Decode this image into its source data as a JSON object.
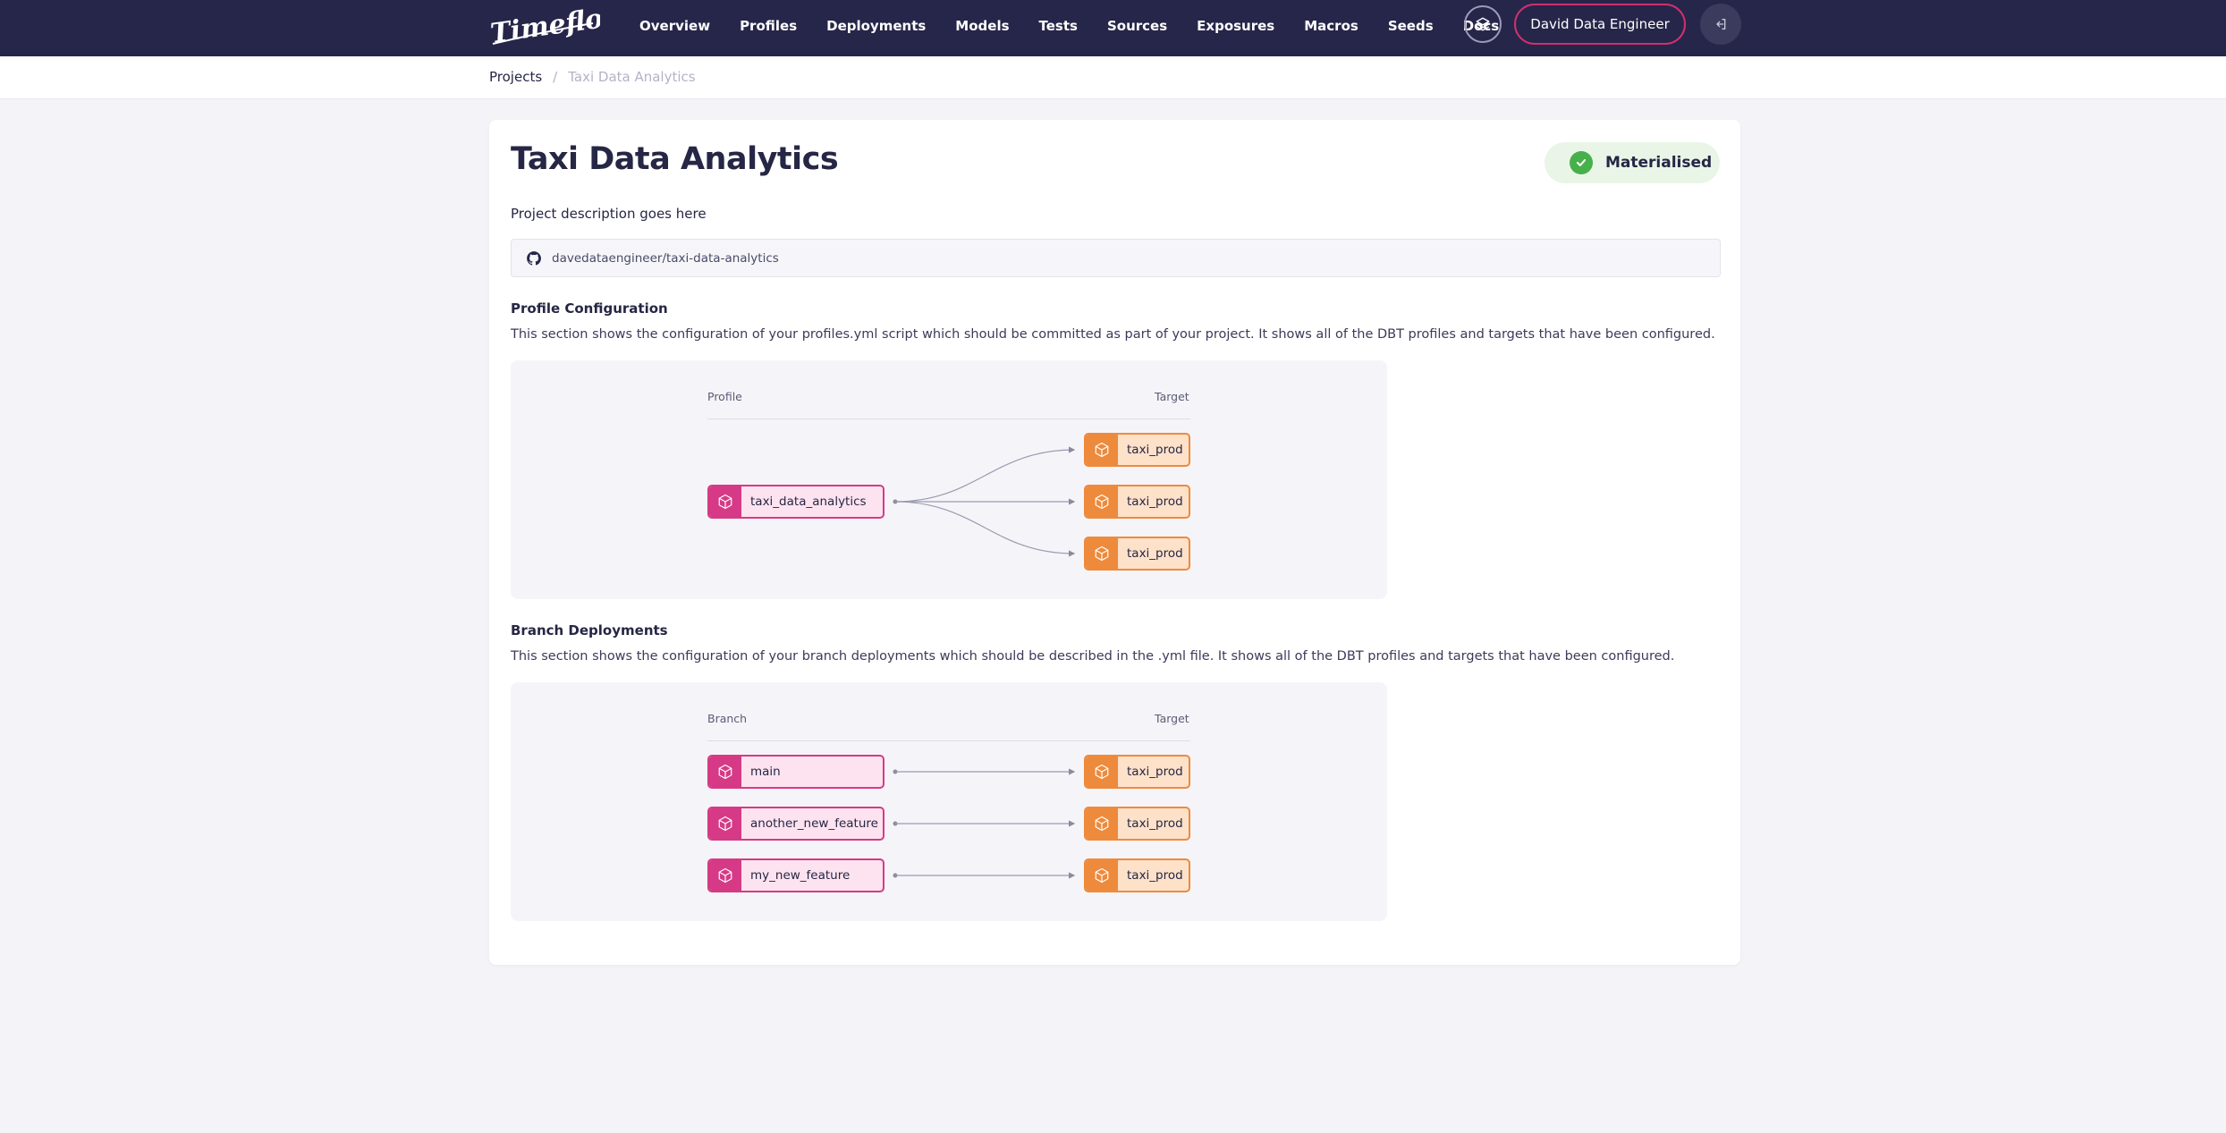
{
  "app": {
    "logo_text": "Timeflow"
  },
  "nav": {
    "items": [
      "Overview",
      "Profiles",
      "Deployments",
      "Models",
      "Tests",
      "Sources",
      "Exposures",
      "Macros",
      "Seeds",
      "Docs"
    ],
    "user_label": "David Data Engineer"
  },
  "breadcrumb": {
    "root": "Projects",
    "separator": "/",
    "current": "Taxi Data Analytics"
  },
  "project": {
    "title": "Taxi Data Analytics",
    "status": "Materialised",
    "description": "Project description goes here",
    "repo": "davedataengineer/taxi-data-analytics"
  },
  "profile_section": {
    "title": "Profile Configuration",
    "description": "This section shows the configuration of your profiles.yml script which should be committed as part of your project. It shows all of the DBT profiles and targets that have been configured.",
    "left_header": "Profile",
    "right_header": "Target",
    "profile": "taxi_data_analytics",
    "targets": [
      "taxi_prod",
      "taxi_prod",
      "taxi_prod"
    ]
  },
  "branch_section": {
    "title": "Branch Deployments",
    "description": "This section shows the configuration of your branch deployments which should be described in the .yml file. It shows all of the DBT profiles and targets that have been configured.",
    "left_header": "Branch",
    "right_header": "Target",
    "branches": [
      "main",
      "another_new_feature",
      "my_new_feature"
    ],
    "targets": [
      "taxi_prod",
      "taxi_prod",
      "taxi_prod"
    ]
  },
  "colors": {
    "nav_bg": "#26264a",
    "accent_pink": "#d63a86",
    "accent_orange": "#ee8a3c",
    "success": "#47b04b"
  }
}
